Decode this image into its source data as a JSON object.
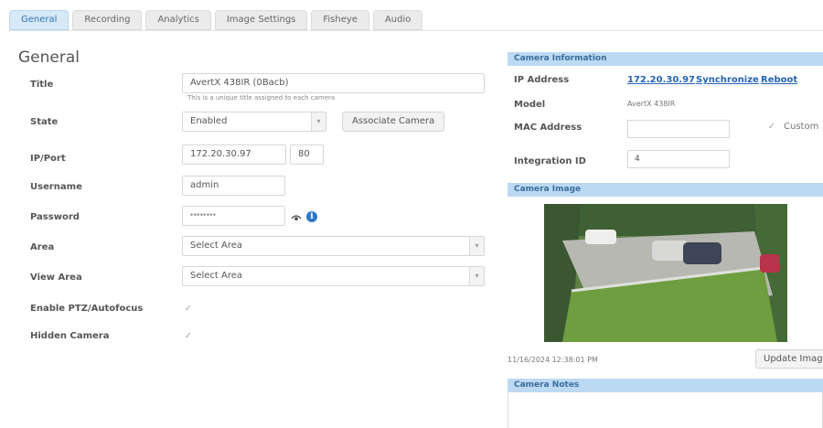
{
  "tabs": [
    {
      "label": "General",
      "active": true
    },
    {
      "label": "Recording"
    },
    {
      "label": "Analytics"
    },
    {
      "label": "Image Settings"
    },
    {
      "label": "Fisheye"
    },
    {
      "label": "Audio"
    }
  ],
  "page_title": "General",
  "form": {
    "title_label": "Title",
    "title_value": "AvertX 438IR (0Bacb)",
    "title_hint": "This is a unique title assigned to each camera",
    "state_label": "State",
    "state_value": "Enabled",
    "associate_button": "Associate Camera",
    "ipport_label": "IP/Port",
    "ip_value": "172.20.30.97",
    "port_value": "80",
    "username_label": "Username",
    "username_value": "admin",
    "password_label": "Password",
    "password_value": "********",
    "area_label": "Area",
    "area_value": "Select Area",
    "view_area_label": "View Area",
    "view_area_value": "Select Area",
    "ptz_label": "Enable PTZ/Autofocus",
    "hidden_label": "Hidden Camera",
    "check_glyph": "✓",
    "select_arrow": "▾"
  },
  "camera_info": {
    "header": "Camera Information",
    "ip_label": "IP Address",
    "ip_link": "172.20.30.97",
    "sync_link": "Synchronize",
    "reboot_link": "Reboot",
    "model_label": "Model",
    "model_value": "AvertX 438IR",
    "mac_label": "MAC Address",
    "mac_value": "",
    "custom_label": "Custom",
    "integration_label": "Integration ID",
    "integration_value": "4"
  },
  "camera_image": {
    "header": "Camera Image",
    "timestamp": "11/16/2024 12:38:01 PM",
    "update_button": "Update Image"
  },
  "camera_notes": {
    "header": "Camera Notes"
  },
  "colors": {
    "accent": "#2e77bb",
    "panel_header": "#bcd9f3",
    "link": "#2464b3",
    "info_icon": "#2a78c7"
  }
}
